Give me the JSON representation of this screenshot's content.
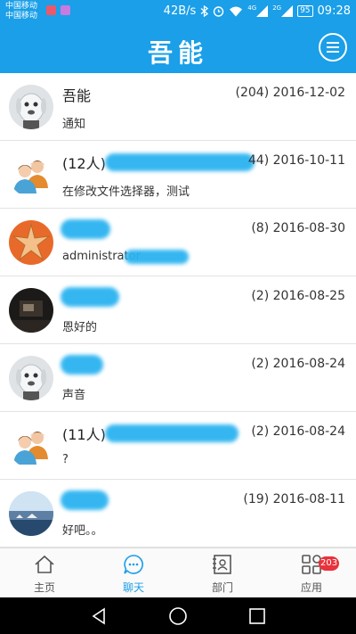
{
  "statusbar": {
    "carrier_1": "中国移动",
    "carrier_2": "中国移动",
    "speed": "42B/s",
    "network_4g": "4G",
    "network_2g": "2G",
    "battery": "95",
    "time": "09:28",
    "icons": [
      "app-notification-icon",
      "app-notification-icon",
      "bluetooth-icon",
      "alarm-icon",
      "wifi-icon",
      "signal-icon",
      "signal-icon"
    ]
  },
  "header": {
    "title": "吾能",
    "menu_icon": "hamburger-menu-icon"
  },
  "chats": [
    {
      "name": "吾能",
      "count": "(204)",
      "date": "2016-12-02",
      "preview": "通知",
      "avatar": "robot"
    },
    {
      "name": "(12人)",
      "count": "44)",
      "date": "2016-10-11",
      "preview": "在修改文件选择器，测试",
      "avatar": "group"
    },
    {
      "name": "",
      "count": "(8)",
      "date": "2016-08-30",
      "preview": "administrator",
      "avatar": "starfish"
    },
    {
      "name": "",
      "count": "(2)",
      "date": "2016-08-25",
      "preview": "恩好的",
      "avatar": "photo-dark"
    },
    {
      "name": "",
      "count": "(2)",
      "date": "2016-08-24",
      "preview": "声音",
      "avatar": "robot"
    },
    {
      "name": "(11人)",
      "count": "(2)",
      "date": "2016-08-24",
      "preview": "?",
      "avatar": "group"
    },
    {
      "name": "",
      "count": "(19)",
      "date": "2016-08-11",
      "preview": "好吧。。",
      "avatar": "photo-sea"
    }
  ],
  "tabs": [
    {
      "label": "主页",
      "icon": "home-icon",
      "active": false
    },
    {
      "label": "聊天",
      "icon": "chat-icon",
      "active": true
    },
    {
      "label": "部门",
      "icon": "contacts-icon",
      "active": false
    },
    {
      "label": "应用",
      "icon": "apps-icon",
      "active": false,
      "badge": "203"
    }
  ],
  "colors": {
    "accent": "#1a9fe8",
    "badge": "#e8323c"
  }
}
